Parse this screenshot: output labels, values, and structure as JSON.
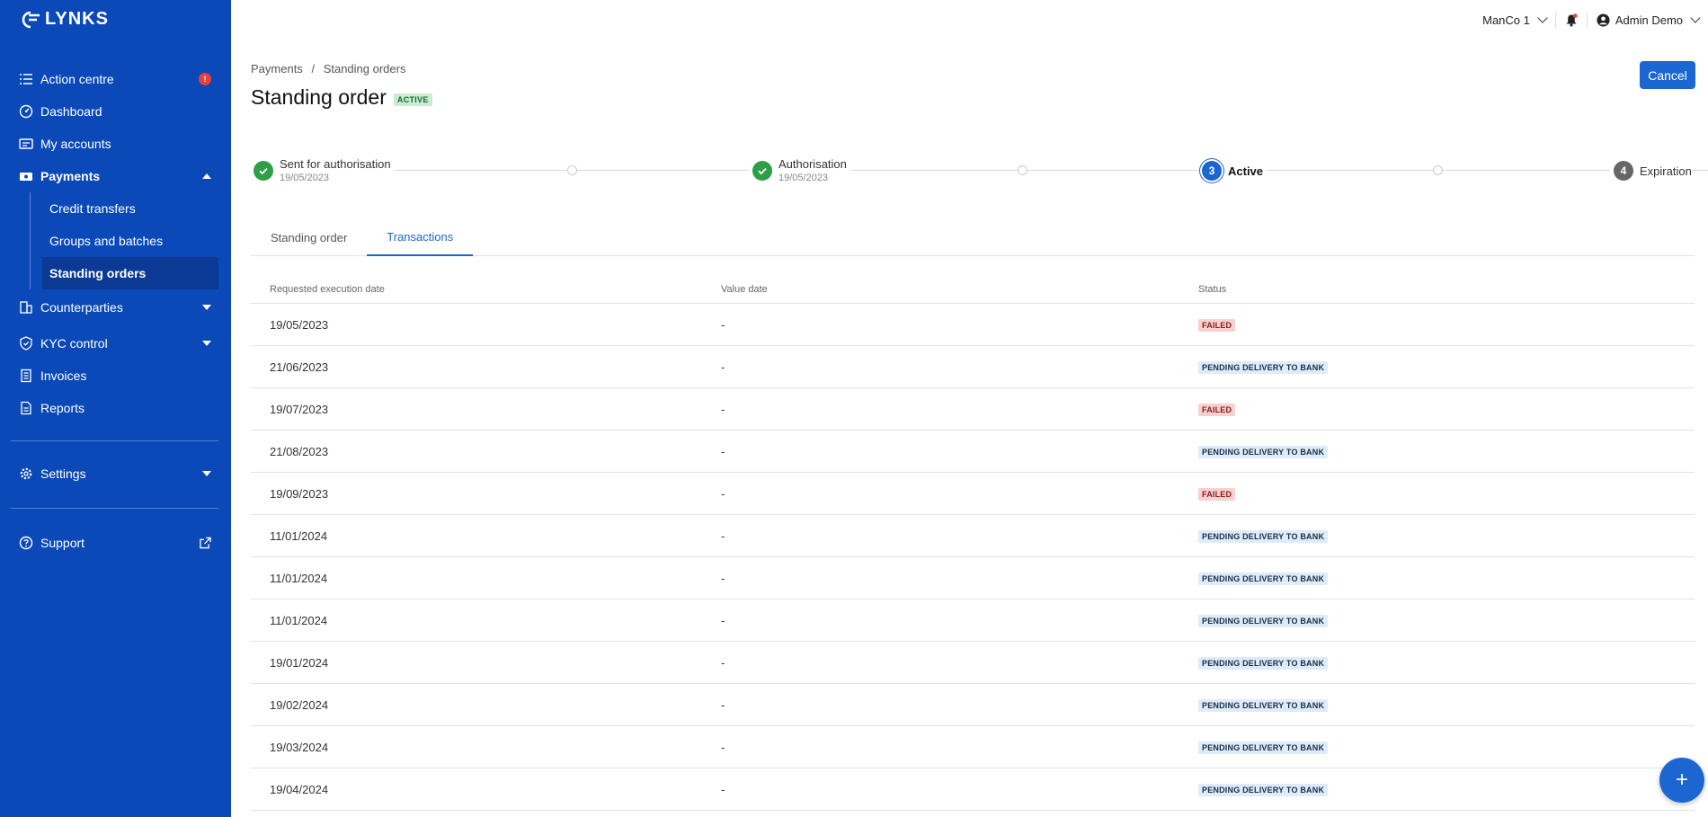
{
  "brand": {
    "name": "LYNKS"
  },
  "sidebar": {
    "items": [
      {
        "label": "Action centre",
        "icon": "list-check-icon",
        "alert": "!"
      },
      {
        "label": "Dashboard",
        "icon": "gauge-icon"
      },
      {
        "label": "My accounts",
        "icon": "accounts-icon"
      },
      {
        "label": "Payments",
        "icon": "money-icon"
      },
      {
        "label": "Counterparties",
        "icon": "building-icon"
      },
      {
        "label": "KYC control",
        "icon": "shield-icon"
      },
      {
        "label": "Invoices",
        "icon": "invoice-icon"
      },
      {
        "label": "Reports",
        "icon": "report-icon"
      },
      {
        "label": "Settings",
        "icon": "gear-icon"
      },
      {
        "label": "Support",
        "icon": "help-icon"
      }
    ],
    "payments_sub": [
      "Credit transfers",
      "Groups and batches",
      "Standing orders"
    ]
  },
  "topbar": {
    "company": "ManCo 1",
    "user": "Admin Demo"
  },
  "breadcrumb": {
    "parent": "Payments",
    "sep": "/",
    "current": "Standing orders"
  },
  "page": {
    "title": "Standing order",
    "status": "ACTIVE",
    "cancel_label": "Cancel"
  },
  "stepper": [
    {
      "label": "Sent for authorisation",
      "date": "19/05/2023",
      "state": "done"
    },
    {
      "label": "Authorisation",
      "date": "19/05/2023",
      "state": "done"
    },
    {
      "label": "Active",
      "number": "3",
      "state": "current"
    },
    {
      "label": "Expiration",
      "number": "4",
      "state": "future"
    }
  ],
  "tabs": [
    {
      "label": "Standing order"
    },
    {
      "label": "Transactions"
    }
  ],
  "table": {
    "headers": [
      "Requested execution date",
      "Value date",
      "Status"
    ],
    "rows": [
      {
        "date": "19/05/2023",
        "value": "-",
        "status": "FAILED",
        "kind": "failed"
      },
      {
        "date": "21/06/2023",
        "value": "-",
        "status": "PENDING DELIVERY TO BANK",
        "kind": "pending"
      },
      {
        "date": "19/07/2023",
        "value": "-",
        "status": "FAILED",
        "kind": "failed"
      },
      {
        "date": "21/08/2023",
        "value": "-",
        "status": "PENDING DELIVERY TO BANK",
        "kind": "pending"
      },
      {
        "date": "19/09/2023",
        "value": "-",
        "status": "FAILED",
        "kind": "failed"
      },
      {
        "date": "11/01/2024",
        "value": "-",
        "status": "PENDING DELIVERY TO BANK",
        "kind": "pending"
      },
      {
        "date": "11/01/2024",
        "value": "-",
        "status": "PENDING DELIVERY TO BANK",
        "kind": "pending"
      },
      {
        "date": "11/01/2024",
        "value": "-",
        "status": "PENDING DELIVERY TO BANK",
        "kind": "pending"
      },
      {
        "date": "19/01/2024",
        "value": "-",
        "status": "PENDING DELIVERY TO BANK",
        "kind": "pending"
      },
      {
        "date": "19/02/2024",
        "value": "-",
        "status": "PENDING DELIVERY TO BANK",
        "kind": "pending"
      },
      {
        "date": "19/03/2024",
        "value": "-",
        "status": "PENDING DELIVERY TO BANK",
        "kind": "pending"
      },
      {
        "date": "19/04/2024",
        "value": "-",
        "status": "PENDING DELIVERY TO BANK",
        "kind": "pending"
      }
    ]
  },
  "fab": {
    "label": "+"
  },
  "colors": {
    "sidebar": "#0b49b8",
    "accent": "#1b66d1",
    "success": "#2e9e47",
    "alert": "#e8403b"
  }
}
